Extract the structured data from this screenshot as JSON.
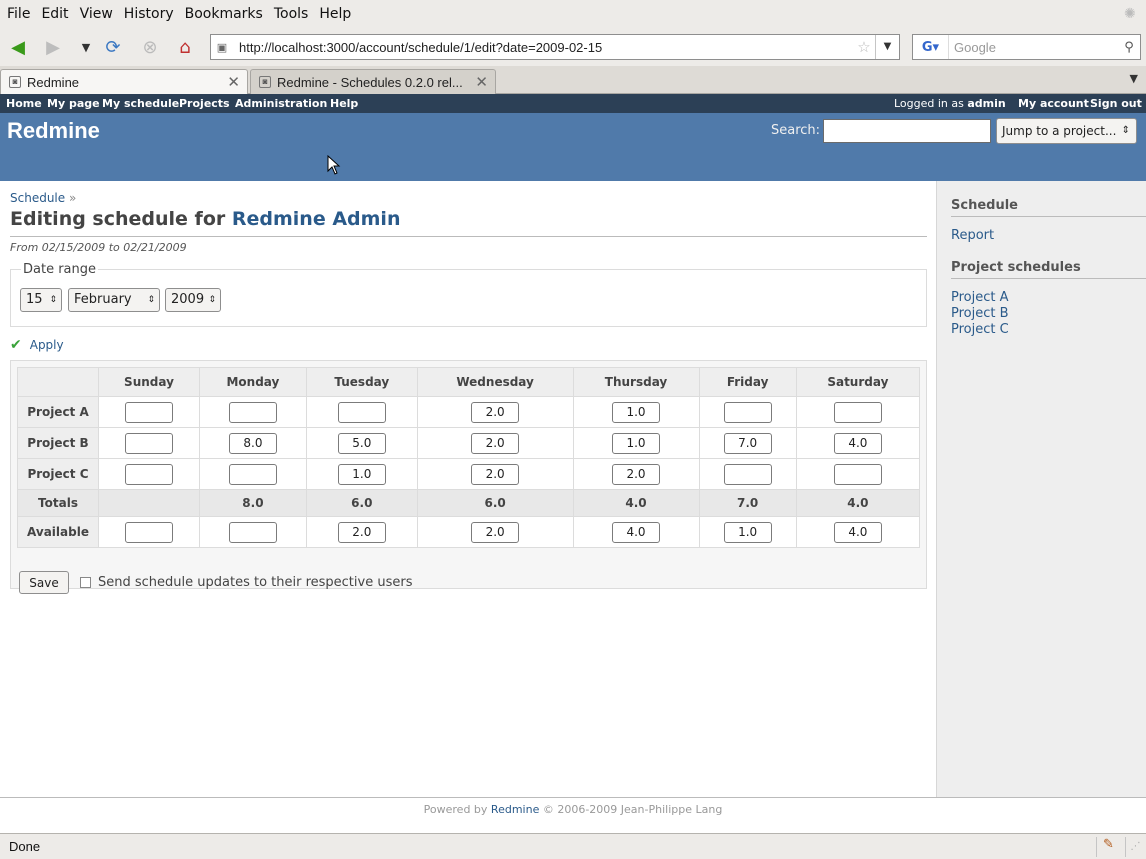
{
  "browser": {
    "menu": [
      "File",
      "Edit",
      "View",
      "History",
      "Bookmarks",
      "Tools",
      "Help"
    ],
    "url": "http://localhost:3000/account/schedule/1/edit?date=2009-02-15",
    "search_placeholder": "Google",
    "tabs": [
      {
        "label": "Redmine"
      },
      {
        "label": "Redmine - Schedules 0.2.0 rel..."
      }
    ],
    "status": "Done"
  },
  "redmine": {
    "top_menu": [
      "Home",
      "My page",
      "My schedule",
      "Projects",
      "Administration",
      "Help"
    ],
    "logged_in_prefix": "Logged in as",
    "logged_in_user": "admin",
    "account_links": [
      "My account",
      "Sign out"
    ],
    "site_title": "Redmine",
    "search_label": "Search:",
    "jump_label": "Jump to a project..."
  },
  "content": {
    "breadcrumb": "Schedule",
    "breadcrumb_sep": "»",
    "title_prefix": "Editing schedule for",
    "title_user": "Redmine Admin",
    "range_text": "From 02/15/2009 to 02/21/2009",
    "date_range_legend": "Date range",
    "day_value": "15",
    "month_value": "February",
    "year_value": "2009",
    "apply_label": "Apply",
    "columns": [
      "Sunday",
      "Monday",
      "Tuesday",
      "Wednesday",
      "Thursday",
      "Friday",
      "Saturday"
    ],
    "rows": [
      {
        "label": "Project A",
        "values": [
          "",
          "",
          "",
          "2.0",
          "1.0",
          "",
          ""
        ]
      },
      {
        "label": "Project B",
        "values": [
          "",
          "8.0",
          "5.0",
          "2.0",
          "1.0",
          "7.0",
          "4.0"
        ]
      },
      {
        "label": "Project C",
        "values": [
          "",
          "",
          "1.0",
          "2.0",
          "2.0",
          "",
          ""
        ]
      }
    ],
    "totals_label": "Totals",
    "totals": [
      "",
      "8.0",
      "6.0",
      "6.0",
      "4.0",
      "7.0",
      "4.0"
    ],
    "available_label": "Available",
    "available": [
      "",
      "",
      "2.0",
      "2.0",
      "4.0",
      "1.0",
      "4.0"
    ],
    "save_label": "Save",
    "notify_label": "Send schedule updates to their respective users"
  },
  "sidebar": {
    "schedule_heading": "Schedule",
    "report_link": "Report",
    "projects_heading": "Project schedules",
    "projects": [
      "Project A",
      "Project B",
      "Project C"
    ]
  },
  "footer": {
    "powered_by": "Powered by",
    "link": "Redmine",
    "copyright": "© 2006-2009 Jean-Philippe Lang"
  },
  "colors": {
    "header_bg": "#507aaa",
    "top_menu_bg": "#2c4056",
    "link": "#2a5a8a",
    "sidebar_bg": "#eeeeee"
  }
}
